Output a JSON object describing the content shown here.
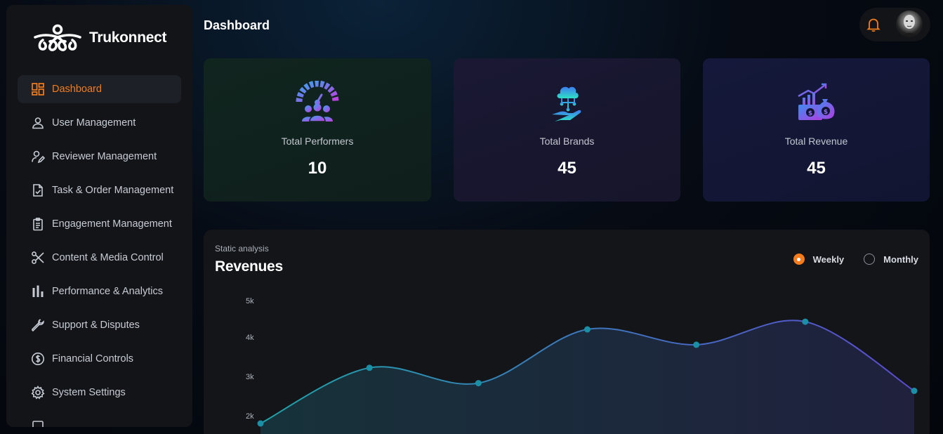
{
  "app": {
    "brand_name": "Trukonnect"
  },
  "sidebar": {
    "items": [
      {
        "label": "Dashboard",
        "icon": "dashboard-icon",
        "active": true
      },
      {
        "label": "User Management",
        "icon": "user-icon"
      },
      {
        "label": "Reviewer Management",
        "icon": "user-edit-icon"
      },
      {
        "label": "Task & Order Management",
        "icon": "file-check-icon"
      },
      {
        "label": "Engagement Management",
        "icon": "clipboard-icon"
      },
      {
        "label": "Content & Media Control",
        "icon": "scissors-icon"
      },
      {
        "label": "Performance & Analytics",
        "icon": "bar-chart-icon"
      },
      {
        "label": "Support & Disputes",
        "icon": "wrench-icon"
      },
      {
        "label": "Financial Controls",
        "icon": "dollar-icon"
      },
      {
        "label": "System Settings",
        "icon": "gear-icon"
      }
    ]
  },
  "header": {
    "title": "Dashboard"
  },
  "stats": [
    {
      "label": "Total Performers",
      "value": "10",
      "icon": "performers-gauge-icon"
    },
    {
      "label": "Total Brands",
      "value": "45",
      "icon": "cloud-hand-icon"
    },
    {
      "label": "Total Revenue",
      "value": "45",
      "icon": "revenue-money-icon"
    }
  ],
  "revenue_panel": {
    "subtitle": "Static analysis",
    "title": "Revenues",
    "options": [
      {
        "label": "Weekly",
        "selected": true
      },
      {
        "label": "Monthly",
        "selected": false
      }
    ]
  },
  "colors": {
    "accent": "#f47c1c",
    "line_start": "#1fa3a8",
    "line_end": "#5c4bd0",
    "point": "#1b8fa6"
  },
  "chart_data": {
    "type": "line",
    "title": "Revenues",
    "y_ticks": [
      "5k",
      "4k",
      "3k",
      "2k"
    ],
    "values": [
      1800,
      3250,
      2850,
      4250,
      3850,
      4450,
      2650
    ],
    "ylim": [
      1800,
      5000
    ],
    "grid": false,
    "legend": "none"
  }
}
